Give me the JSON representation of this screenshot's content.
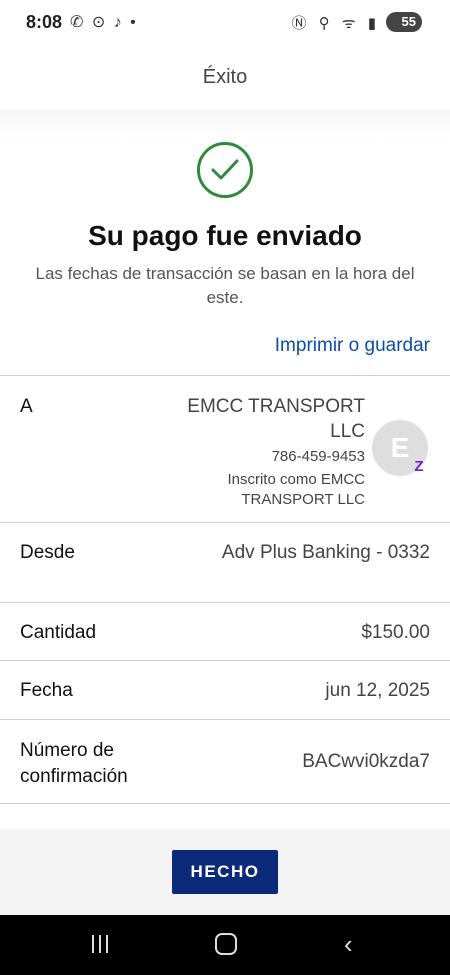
{
  "status_bar": {
    "time": "8:08",
    "left_icons": [
      "missed-call-icon",
      "vpn-icon",
      "tiktok-icon",
      "dot-icon"
    ],
    "left_icons_text": "✆ ⊙ ♪ •",
    "right_icons_text": "Ⓝ ⚲ ᯤ ▮",
    "battery": "55"
  },
  "header": {
    "title": "Éxito"
  },
  "success": {
    "headline": "Su pago fue enviado",
    "subtitle": "Las fechas de transacción se basan en la hora del este.",
    "print_link": "Imprimir o guardar",
    "check_color": "#2e8b3a"
  },
  "details": {
    "to_label": "A",
    "payee_name": "EMCC TRANSPORT LLC",
    "payee_phone": "786-459-9453",
    "payee_enrolled": "Inscrito como EMCC TRANSPORT LLC",
    "avatar_initial": "E",
    "zelle_badge": "Z",
    "from_label": "Desde",
    "from_value": "Adv Plus Banking - 0332",
    "amount_label": "Cantidad",
    "amount_value": "$150.00",
    "date_label": "Fecha",
    "date_value": "jun 12, 2025",
    "confirmation_label": "Número de confirmación",
    "confirmation_value": "BACwvi0kzda7"
  },
  "footer": {
    "done_label": "HECHO",
    "button_color": "#0c2a7a"
  },
  "nav": {
    "back_glyph": "‹"
  }
}
